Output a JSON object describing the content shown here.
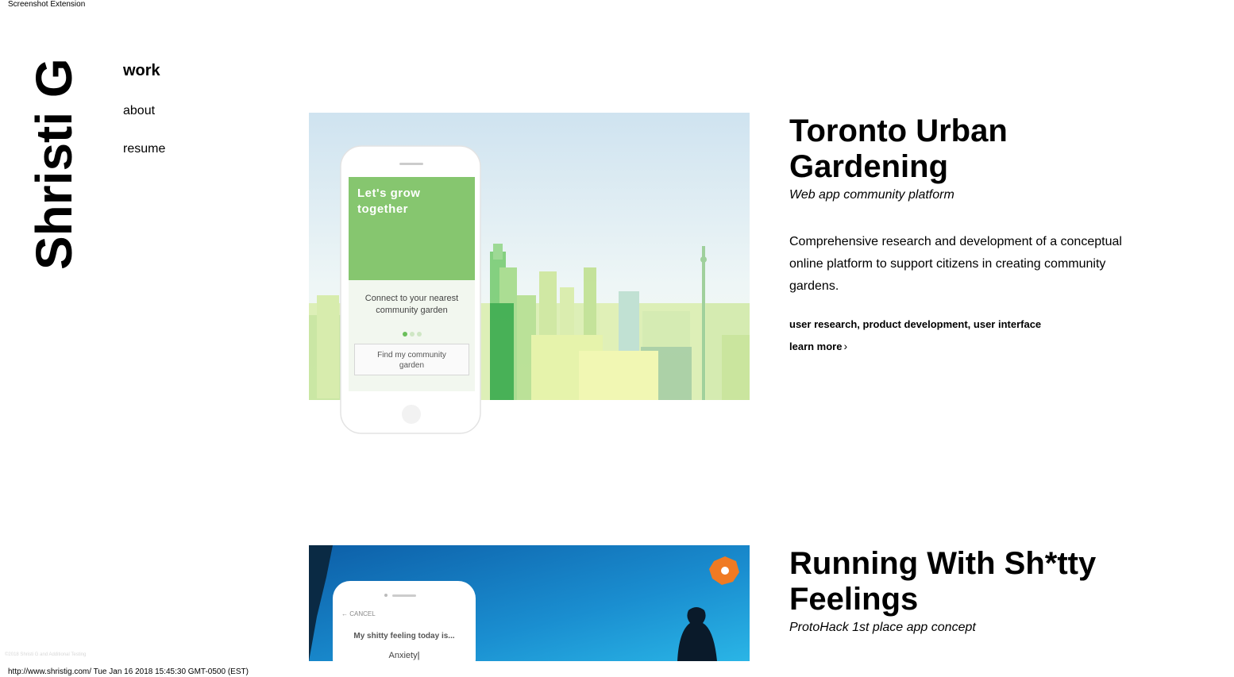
{
  "extension_label": "Screenshot Extension",
  "logo": "Shristi G",
  "nav": {
    "work": "work",
    "about": "about",
    "resume": "resume"
  },
  "projects": [
    {
      "title": "Toronto Urban Gardening",
      "subtitle": "Web app community platform",
      "description": "Comprehensive research and development of a conceptual online platform to support citizens in creating community gardens.",
      "tags": "user research, product development, user interface",
      "learn_more": "learn more",
      "mockup": {
        "headline_1": "Let's grow",
        "headline_2": "together",
        "body_1": "Connect to your nearest",
        "body_2": "community garden",
        "button_1": "Find my community",
        "button_2": "garden"
      }
    },
    {
      "title": "Running With Sh*tty Feelings",
      "subtitle": "ProtoHack 1st place app concept",
      "mockup": {
        "cancel": "CANCEL",
        "prompt": "My shitty feeling today is...",
        "input_value": "Anxiety"
      }
    }
  ],
  "copyright": "©2018 Shristi G and Additional Testing",
  "status_bar": "http://www.shristig.com/ Tue Jan 16 2018 15:45:30 GMT-0500 (EST)",
  "colors": {
    "sky_top": "#cfe3f0",
    "garden_green": "#8cc870",
    "deep_green": "#3fae4f",
    "ocean_blue": "#1a8ed0",
    "accent_orange": "#f07a22"
  }
}
